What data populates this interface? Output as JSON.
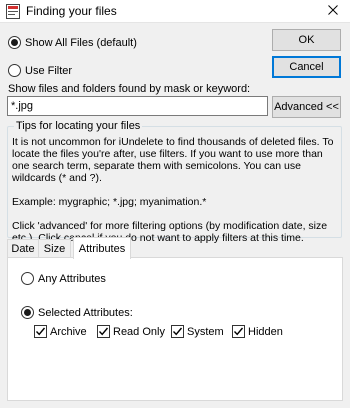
{
  "window": {
    "title": "Finding your files",
    "icon": "app-icon",
    "close_glyph": "✕"
  },
  "options": {
    "show_all": {
      "label": "Show All Files (default)",
      "checked": true
    },
    "use_filter": {
      "label": "Use Filter",
      "checked": false
    }
  },
  "buttons": {
    "ok": "OK",
    "cancel": "Cancel",
    "advanced": "Advanced <<"
  },
  "mask": {
    "label": "Show files and folders found by mask or keyword:",
    "value": "*.jpg"
  },
  "tips": {
    "title": "Tips for locating your files",
    "paragraph1": "It is not uncommon for iUndelete to find thousands of deleted files. To locate the files you're after, use filters. If you want to use more than one search term, separate them with semicolons. You can use wildcards (* and ?).",
    "paragraph2": "Example: mygraphic; *.jpg; myanimation.*",
    "paragraph3": "Click 'advanced' for more filtering options (by modification date, size etc.). Click cancel if you do not want to apply filters at this time."
  },
  "tabs": [
    {
      "label": "Date",
      "active": false
    },
    {
      "label": "Size",
      "active": false
    },
    {
      "label": "Attributes",
      "active": true
    }
  ],
  "attributes": {
    "any": {
      "label": "Any Attributes",
      "checked": false
    },
    "selected": {
      "label": "Selected Attributes:",
      "checked": true
    },
    "items": [
      {
        "label": "Archive",
        "checked": true
      },
      {
        "label": "Read Only",
        "checked": true
      },
      {
        "label": "System",
        "checked": true
      },
      {
        "label": "Hidden",
        "checked": true
      }
    ]
  },
  "colors": {
    "accent": "#0078d7",
    "dialog_bg": "#f0f0f0"
  }
}
